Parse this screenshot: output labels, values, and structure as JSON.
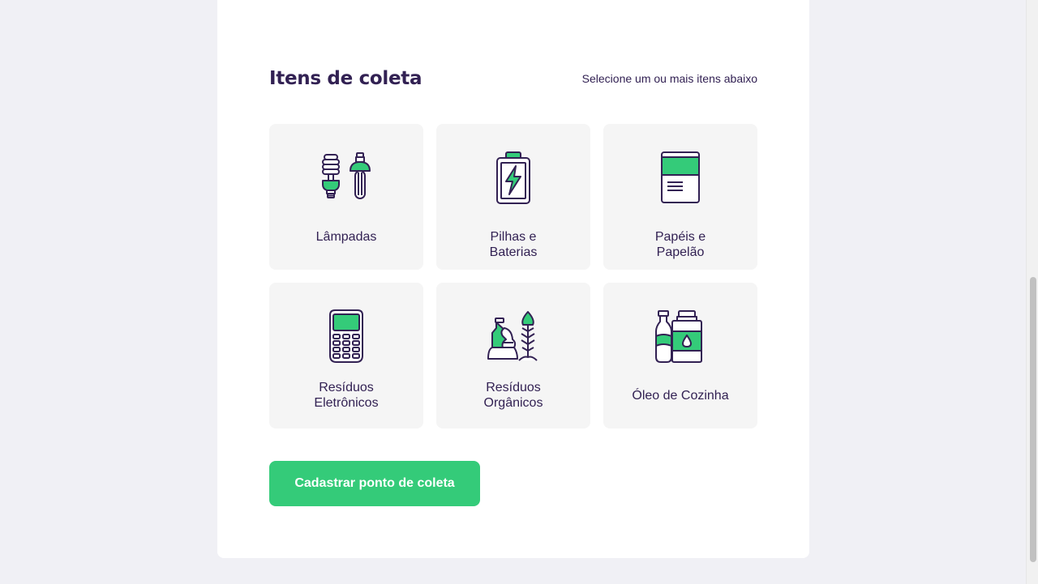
{
  "section": {
    "title": "Itens de coleta",
    "hint": "Selecione um ou mais itens abaixo"
  },
  "items": [
    {
      "label": "Lâmpadas",
      "icon": "lamp-icon"
    },
    {
      "label": "Pilhas e Baterias",
      "icon": "battery-icon"
    },
    {
      "label": "Papéis e Papelão",
      "icon": "paper-icon"
    },
    {
      "label": "Resíduos Eletrônicos",
      "icon": "electronics-icon"
    },
    {
      "label": "Resíduos Orgânicos",
      "icon": "organic-icon"
    },
    {
      "label": "Óleo de Cozinha",
      "icon": "oil-icon"
    }
  ],
  "submit_label": "Cadastrar ponto de coleta",
  "colors": {
    "accent": "#34CB79",
    "text": "#322153",
    "background": "#F0F0F5",
    "card": "#FFFFFF",
    "item_bg": "#F5F5F5"
  }
}
